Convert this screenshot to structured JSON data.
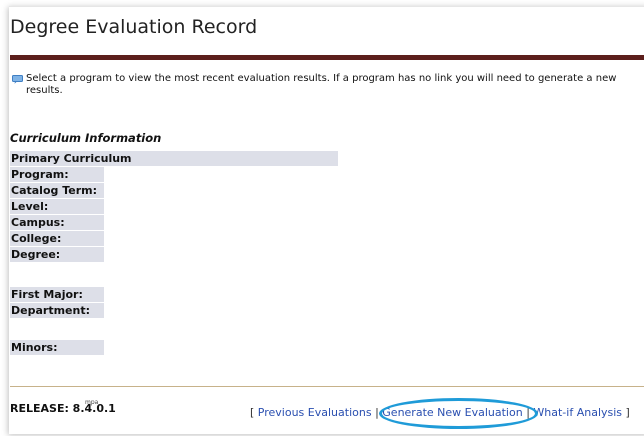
{
  "page": {
    "title": "Degree Evaluation Record",
    "info_text": "Select a program to view the most recent evaluation results. If a program has no link you will need to generate a new results."
  },
  "curriculum": {
    "heading": "Curriculum Information",
    "primary": "Primary Curriculum",
    "fields": {
      "program": "Program:",
      "catalog_term": "Catalog Term:",
      "level": "Level:",
      "campus": "Campus:",
      "college": "College:",
      "degree": "Degree:",
      "first_major": "First Major:",
      "department": "Department:",
      "minors": "Minors:"
    }
  },
  "footer": {
    "release": "RELEASE: 8.4.0.1",
    "release_tag": "mpa",
    "open_bracket": "[",
    "close_bracket": "]",
    "separator": "|",
    "links": {
      "previous": "Previous Evaluations",
      "generate": "Generate New Evaluation",
      "whatif": "What-if Analysis"
    }
  },
  "colors": {
    "title_rule": "#5c1f1c",
    "label_bg": "#dddfe8",
    "link": "#2a4fb0",
    "highlight": "#1f9bd8"
  }
}
